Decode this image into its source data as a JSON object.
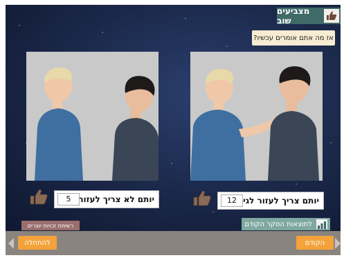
{
  "header": {
    "title": "מצביעים שוב",
    "icon": "thumbs-up-icon"
  },
  "question": "אז מה אתם אומרים עכשיו?",
  "options": [
    {
      "label": "יותם צריך לעזור לגיא",
      "count": "12",
      "side": "right"
    },
    {
      "label": "יותם לא צריך לעזור לגיא",
      "count": "5",
      "side": "left"
    }
  ],
  "buttons": {
    "rights": "רשימת זכויות יוצרים",
    "results": "לתוצאות הסקר הקודם",
    "prev": "הקודם",
    "start": "להתחלה"
  },
  "colors": {
    "header_bg": "#3f6a68",
    "nav_orange": "#f3a33a",
    "bottom_bar": "#8a847f",
    "results_bg": "#7fa8a0",
    "rights_bg": "#9b6e6e"
  }
}
